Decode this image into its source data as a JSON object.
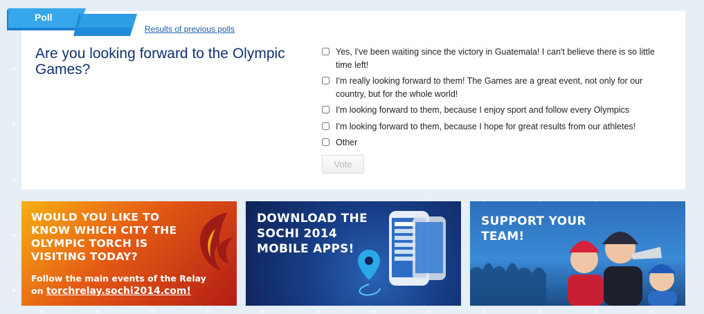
{
  "poll": {
    "tab_label": "Poll",
    "results_link": "Results of previous polls",
    "question": "Are you looking forward to the Olympic Games?",
    "options": [
      "Yes, I've been waiting since the victory in Guatemala! I can't believe there is so little time left!",
      "I'm really looking forward to them! The Games are a great event, not only for our country, but for the whole world!",
      "I'm looking forward to them, because I enjoy sport and follow every Olympics",
      "I'm looking forward to them, because I hope for great results from our athletes!",
      "Other"
    ],
    "vote_label": "Vote"
  },
  "banners": {
    "relay": {
      "headline": "Would you like to know which city the Olympic torch is visiting today?",
      "subtext": "Follow the main events of the Relay",
      "prefix": "on",
      "link": "torchrelay.sochi2014.com!"
    },
    "apps": {
      "headline": "Download the Sochi 2014 mobile apps!"
    },
    "team": {
      "headline": "Support your team!"
    }
  },
  "colors": {
    "tab_blue": "#2c9ce0",
    "question_navy": "#12306b",
    "link_blue": "#1a5fa8"
  },
  "icons": [
    "flame-icon",
    "phone-icon",
    "location-pin-icon",
    "fans-icon",
    "people-icon"
  ]
}
